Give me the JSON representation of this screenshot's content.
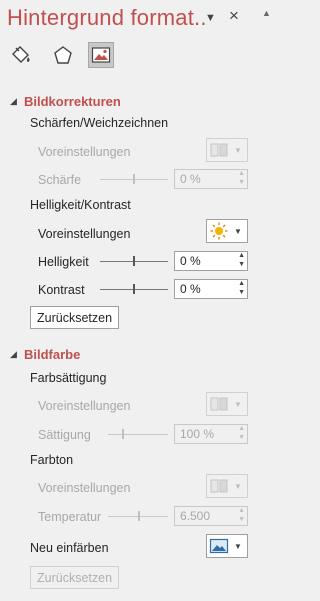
{
  "pane": {
    "title": "Hintergrund format..",
    "close_symbol": "×"
  },
  "tabs": [
    {
      "name": "Füllung",
      "icon": "paint-bucket-icon"
    },
    {
      "name": "Effekte",
      "icon": "pentagon-icon"
    },
    {
      "name": "Bild",
      "icon": "picture-icon",
      "selected": true
    }
  ],
  "bildkorrekturen": {
    "header": "Bildkorrekturen",
    "schaerfen_title": "Schärfen/Weichzeichnen",
    "schaerfen_presets_label": "Voreinstellungen",
    "schaerfe_label": "Schärfe",
    "schaerfe_value": "0 %",
    "helligkeit_title": "Helligkeit/Kontrast",
    "helligkeit_presets_label": "Voreinstellungen",
    "helligkeit_label": "Helligkeit",
    "helligkeit_value": "0 %",
    "kontrast_label": "Kontrast",
    "kontrast_value": "0 %",
    "reset_label": "Zurücksetzen"
  },
  "bildfarbe": {
    "header": "Bildfarbe",
    "saettigung_title": "Farbsättigung",
    "saettigung_presets_label": "Voreinstellungen",
    "saettigung_label": "Sättigung",
    "saettigung_value": "100 %",
    "farbton_title": "Farbton",
    "farbton_presets_label": "Voreinstellungen",
    "temperatur_label": "Temperatur",
    "temperatur_value": "6.500",
    "neu_einfaerben_label": "Neu einfärben",
    "reset_label": "Zurücksetzen"
  },
  "colors": {
    "accent": "#c0504d",
    "disabled_text": "#a8a8a8",
    "background": "#f0f0f0"
  }
}
